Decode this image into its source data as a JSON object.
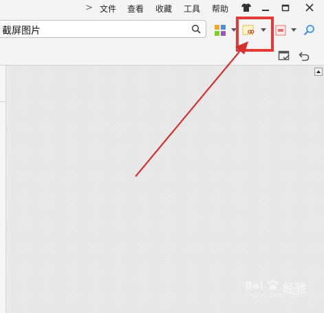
{
  "menu": {
    "items": [
      {
        "label": "文件"
      },
      {
        "label": "查看"
      },
      {
        "label": "收藏"
      },
      {
        "label": "工具"
      },
      {
        "label": "帮助"
      }
    ]
  },
  "search": {
    "value": "截屏图片"
  },
  "watermark": {
    "brand_lat": "Bai",
    "brand_cn": "经验",
    "url": "jingyan.baidu.com"
  },
  "colors": {
    "highlight": "#e53935",
    "arrow": "#d32f2f",
    "content_bg": "#e8e8e8"
  },
  "icons": [
    "chevron-right-icon",
    "skin-shirt-icon",
    "minimize-icon",
    "restore-icon",
    "close-icon",
    "search-icon",
    "apps-grid-icon",
    "screenshot-icon",
    "translate-icon",
    "magnifier-icon",
    "window-check-icon",
    "undo-icon"
  ]
}
